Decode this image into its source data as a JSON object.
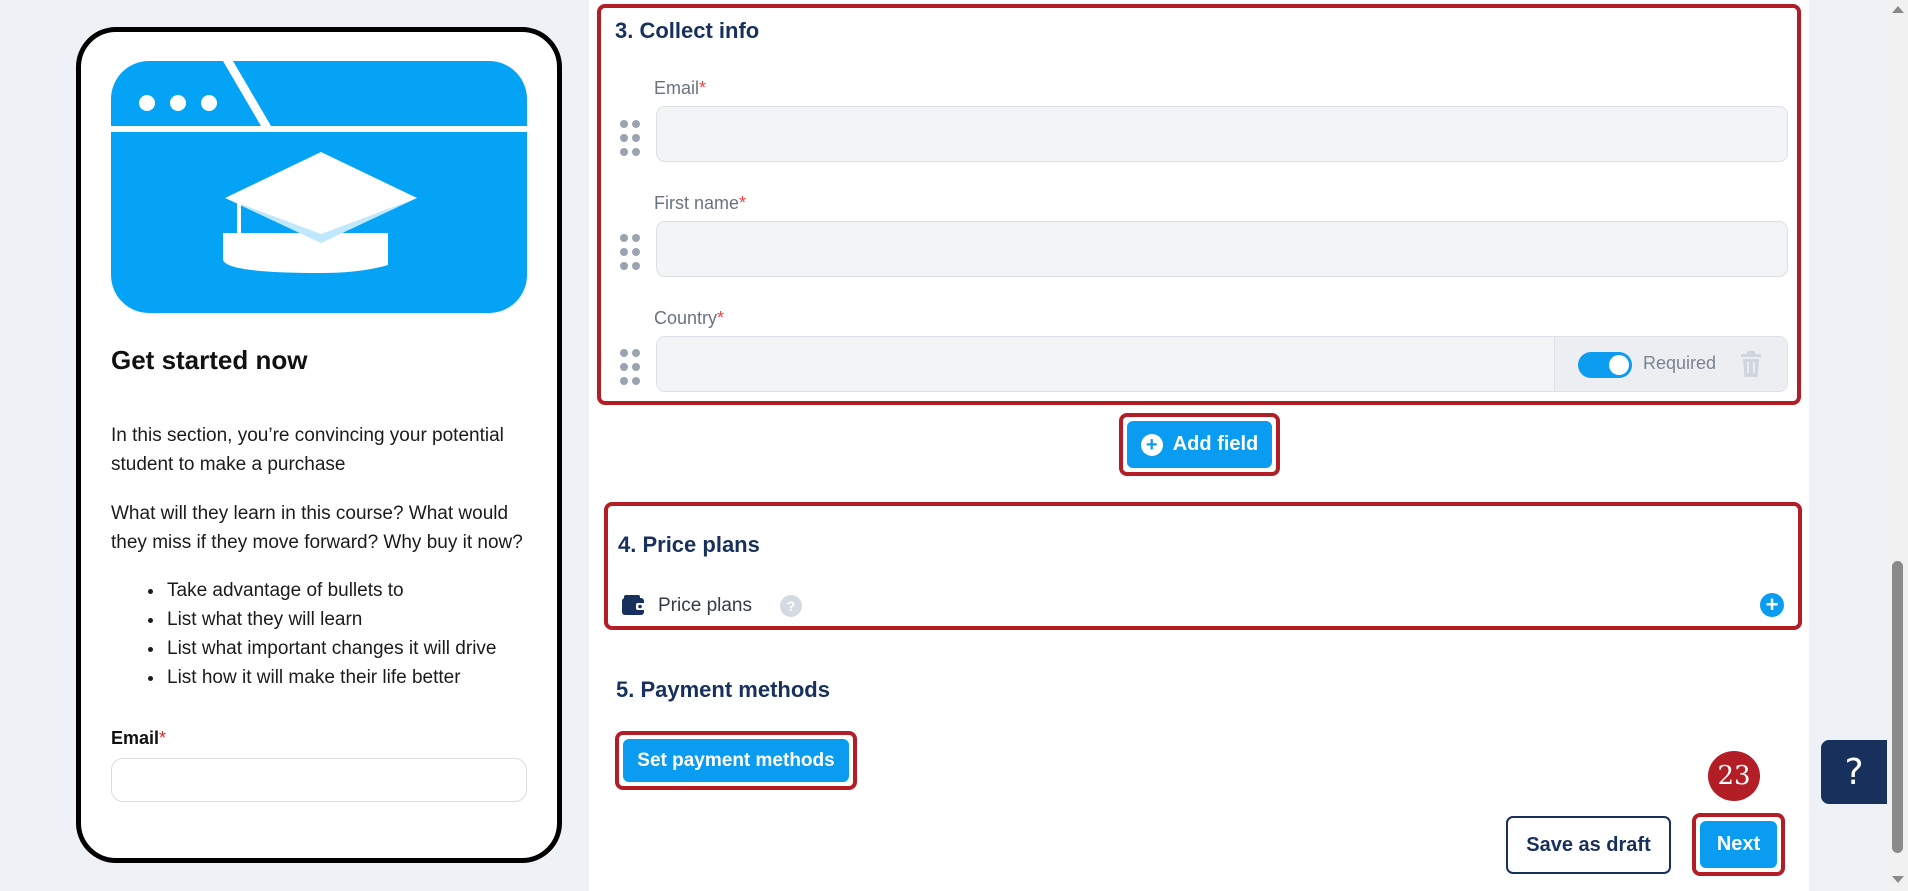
{
  "preview": {
    "title": "Get started now",
    "paragraph1": "In this section, you’re convincing your potential student to make a purchase",
    "paragraph2": "What will they learn in this course? What would they miss if they move forward? Why buy it now?",
    "bullets": [
      "Take advantage of bullets to",
      "List what they will learn",
      "List what important changes it will drive",
      "List how it will make their life better"
    ],
    "email_label": "Email",
    "required_mark": "*",
    "hero_icon": "graduation-cap-browser-illustration",
    "hero_color": "#05a3f5"
  },
  "collect_info": {
    "heading": "3. Collect info",
    "fields": [
      {
        "label": "Email",
        "required_mark": "*",
        "value": ""
      },
      {
        "label": "First name",
        "required_mark": "*",
        "value": ""
      },
      {
        "label": "Country",
        "required_mark": "*",
        "value": "",
        "required_toggle_label": "Required",
        "required_toggle_on": true
      }
    ],
    "add_field_label": "Add field"
  },
  "price_plans": {
    "heading": "4. Price plans",
    "row_label": "Price plans",
    "help_icon": "question-icon",
    "add_icon": "plus-circle-icon"
  },
  "payment_methods": {
    "heading": "5. Payment methods",
    "button_label": "Set payment methods"
  },
  "footer": {
    "draft_label": "Save as draft",
    "next_label": "Next",
    "step_badge": "23"
  },
  "help_widget": {
    "label": "?"
  },
  "colors": {
    "accent": "#0a9cf0",
    "navy": "#17305c",
    "highlight": "#b31d26"
  }
}
